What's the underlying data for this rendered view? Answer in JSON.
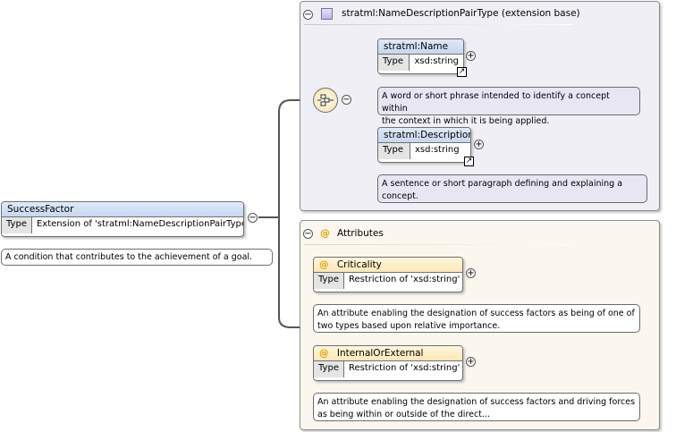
{
  "root": {
    "name": "SuccessFactor",
    "type_key": "Type",
    "type_value": "Extension of 'stratml:NameDescriptionPairType'",
    "doc": "A condition that contributes to the achievement of a goal."
  },
  "extension_group": {
    "title": "stratml:NameDescriptionPairType (extension base)",
    "elements": [
      {
        "name": "stratml:Name",
        "type_key": "Type",
        "type_value": "xsd:string",
        "doc_line1": "A word or short phrase intended to identify a concept within",
        "doc_line2": "the context in which it is being applied."
      },
      {
        "name": "stratml:Description",
        "type_key": "Type",
        "type_value": "xsd:string",
        "doc_line1": "A sentence or short paragraph defining and explaining a",
        "doc_line2": "concept."
      }
    ]
  },
  "attributes_group": {
    "title": "Attributes",
    "items": [
      {
        "name": "Criticality",
        "type_key": "Type",
        "type_value": "Restriction of 'xsd:string'",
        "doc_line1": "An attribute enabling the designation of success factors as being of one of",
        "doc_line2": "two types based upon relative importance."
      },
      {
        "name": "InternalOrExternal",
        "type_key": "Type",
        "type_value": "Restriction of 'xsd:string'",
        "doc_line1": "An attribute enabling the designation of success factors and driving forces",
        "doc_line2": "as being within or outside of the direct..."
      }
    ]
  },
  "symbols": {
    "collapse": "−",
    "expand": "+",
    "attr_marker": "@"
  }
}
